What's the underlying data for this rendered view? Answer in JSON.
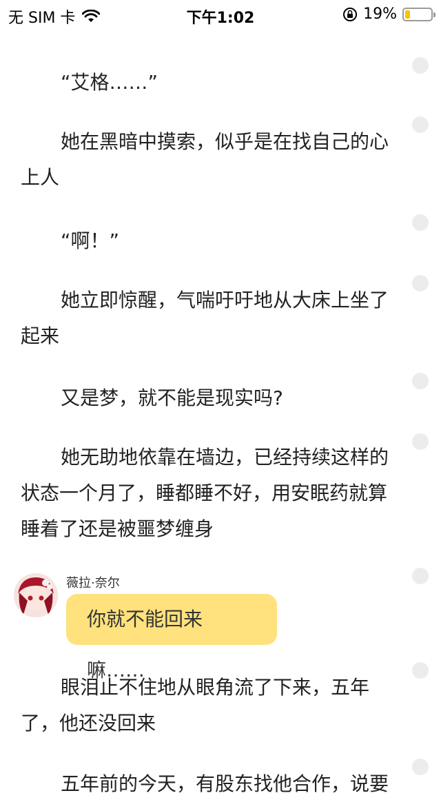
{
  "status_bar": {
    "carrier": "无 SIM 卡",
    "time": "下午1:02",
    "battery_percent": "19%",
    "battery_level": 0.19,
    "icons": [
      "wifi-icon",
      "rotation-lock-icon",
      "battery-icon"
    ]
  },
  "story": {
    "paragraphs": [
      "“艾格……”",
      "她在黑暗中摸索，似乎是在找自己的心上人",
      "“啊！”",
      "她立即惊醒，气喘吁吁地从大床上坐了起来",
      "又是梦，就不能是现实吗?",
      "她无助地依靠在墙边，已经持续这样的状态一个月了，睡都睡不好，用安眠药就算睡着了还是被噩梦缠身",
      "眼泪止不住地从眼角流了下来，五年了，他还没回来",
      "五年前的今天，有股东找他合作，说要"
    ],
    "chat": {
      "speaker": "薇拉·奈尔",
      "message": "你就不能回来嘛……"
    }
  },
  "colors": {
    "bubble": "#ffe17d",
    "side_dot": "#ececec",
    "battery_fill": "#f5c400"
  }
}
